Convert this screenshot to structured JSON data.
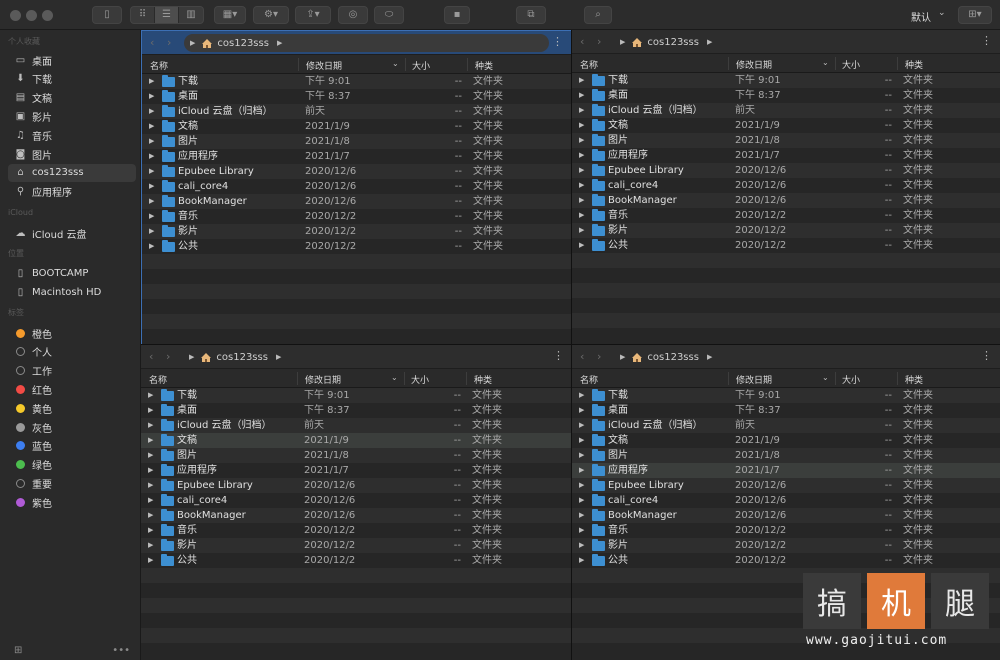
{
  "toolbar": {
    "sort_label": "默认"
  },
  "sidebar": {
    "sections": {
      "favorites": "个人收藏",
      "icloud": "iCloud",
      "locations": "位置",
      "tags": "标签"
    },
    "favorites": [
      {
        "label": "桌面",
        "icon": "desktop-icon"
      },
      {
        "label": "下载",
        "icon": "download-icon"
      },
      {
        "label": "文稿",
        "icon": "document-icon"
      },
      {
        "label": "影片",
        "icon": "film-icon"
      },
      {
        "label": "音乐",
        "icon": "music-icon"
      },
      {
        "label": "图片",
        "icon": "camera-icon"
      },
      {
        "label": "cos123sss",
        "icon": "home-icon"
      },
      {
        "label": "应用程序",
        "icon": "applications-icon"
      }
    ],
    "icloud": [
      {
        "label": "iCloud 云盘",
        "icon": "icloud-icon"
      }
    ],
    "locations": [
      {
        "label": "BOOTCAMP",
        "icon": "disk-icon"
      },
      {
        "label": "Macintosh HD",
        "icon": "disk-icon"
      }
    ],
    "tags": [
      {
        "label": "橙色",
        "color": "#f59a2c"
      },
      {
        "label": "个人",
        "color": ""
      },
      {
        "label": "工作",
        "color": ""
      },
      {
        "label": "红色",
        "color": "#f24b45"
      },
      {
        "label": "黄色",
        "color": "#f5c92a"
      },
      {
        "label": "灰色",
        "color": "#9a9a9a"
      },
      {
        "label": "蓝色",
        "color": "#3d7ef0"
      },
      {
        "label": "绿色",
        "color": "#4cbd4e"
      },
      {
        "label": "重要",
        "color": ""
      },
      {
        "label": "紫色",
        "color": "#b05bd6"
      }
    ]
  },
  "pane": {
    "path": "cos123sss",
    "columns": {
      "name": "名称",
      "date": "修改日期",
      "size": "大小",
      "kind": "种类"
    },
    "rows": [
      {
        "name": "下载",
        "date": "下午 9:01",
        "size": "--",
        "kind": "文件夹"
      },
      {
        "name": "桌面",
        "date": "下午 8:37",
        "size": "--",
        "kind": "文件夹"
      },
      {
        "name": "iCloud 云盘（归档）",
        "date": "前天",
        "size": "--",
        "kind": "文件夹"
      },
      {
        "name": "文稿",
        "date": "2021/1/9",
        "size": "--",
        "kind": "文件夹"
      },
      {
        "name": "图片",
        "date": "2021/1/8",
        "size": "--",
        "kind": "文件夹"
      },
      {
        "name": "应用程序",
        "date": "2021/1/7",
        "size": "--",
        "kind": "文件夹"
      },
      {
        "name": "Epubee Library",
        "date": "2020/12/6",
        "size": "--",
        "kind": "文件夹"
      },
      {
        "name": "cali_core4",
        "date": "2020/12/6",
        "size": "--",
        "kind": "文件夹"
      },
      {
        "name": "BookManager",
        "date": "2020/12/6",
        "size": "--",
        "kind": "文件夹"
      },
      {
        "name": "音乐",
        "date": "2020/12/2",
        "size": "--",
        "kind": "文件夹"
      },
      {
        "name": "影片",
        "date": "2020/12/2",
        "size": "--",
        "kind": "文件夹"
      },
      {
        "name": "公共",
        "date": "2020/12/2",
        "size": "--",
        "kind": "文件夹"
      }
    ]
  },
  "watermark": {
    "chars": [
      "搞",
      "机",
      "腿"
    ],
    "url": "www.gaojitui.com"
  }
}
